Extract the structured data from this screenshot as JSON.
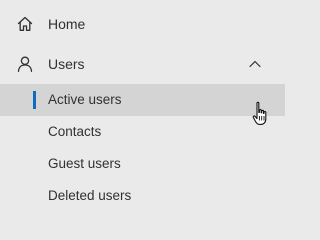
{
  "nav": {
    "home": {
      "label": "Home",
      "icon": "home-icon"
    },
    "users": {
      "label": "Users",
      "icon": "user-icon",
      "expanded": true,
      "toggle_icon": "chevron-up-icon",
      "children": [
        {
          "label": "Active users",
          "selected": true
        },
        {
          "label": "Contacts",
          "selected": false
        },
        {
          "label": "Guest users",
          "selected": false
        },
        {
          "label": "Deleted users",
          "selected": false
        }
      ]
    }
  },
  "colors": {
    "background": "#eaeaea",
    "selected_background": "#d4d4d4",
    "accent": "#0f6cbd",
    "text": "#323130"
  },
  "cursor": {
    "type": "hand-pointer-cursor"
  }
}
